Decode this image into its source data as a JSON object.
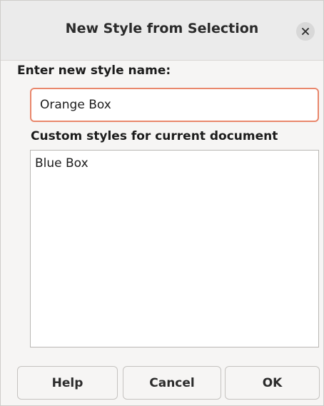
{
  "dialog": {
    "title": "New Style from Selection",
    "close_icon": "close-icon"
  },
  "name_section": {
    "label": "Enter new style name:",
    "input_value": "Orange Box"
  },
  "list_section": {
    "label": "Custom styles for current document",
    "items": [
      "Blue Box"
    ]
  },
  "buttons": {
    "help": "Help",
    "cancel": "Cancel",
    "ok": "OK"
  },
  "colors": {
    "input_focus_border": "#e9876c",
    "titlebar_bg": "#ebebeb",
    "dialog_bg": "#f6f5f4"
  }
}
